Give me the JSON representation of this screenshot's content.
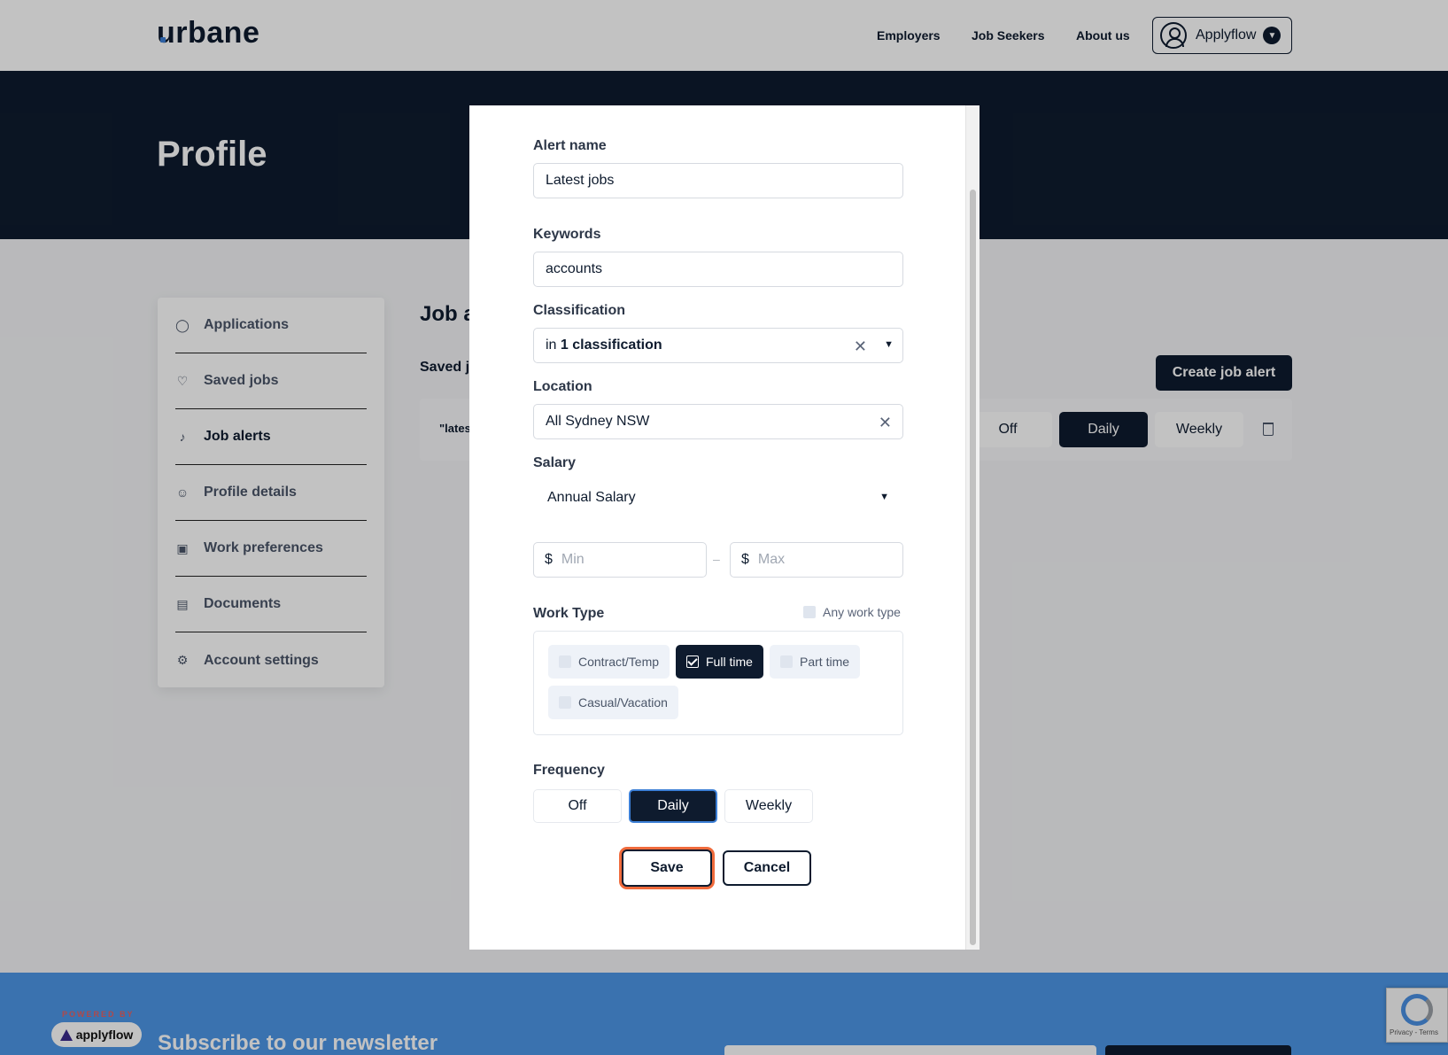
{
  "header": {
    "logo": "urbane",
    "nav": [
      "Employers",
      "Job Seekers",
      "About us"
    ],
    "account_label": "Applyflow"
  },
  "hero": {
    "title": "Profile"
  },
  "sidebar": {
    "items": [
      {
        "label": "Applications",
        "icon": "check-circle-icon"
      },
      {
        "label": "Saved jobs",
        "icon": "heart-icon"
      },
      {
        "label": "Job alerts",
        "icon": "bell-icon",
        "active": true
      },
      {
        "label": "Profile details",
        "icon": "user-circle-icon"
      },
      {
        "label": "Work preferences",
        "icon": "briefcase-icon"
      },
      {
        "label": "Documents",
        "icon": "document-icon"
      },
      {
        "label": "Account settings",
        "icon": "gear-icon"
      }
    ]
  },
  "main": {
    "heading": "Job a",
    "saved_heading": "Saved jo",
    "create_alert_label": "Create job alert",
    "alert_row": {
      "name": "\"lates",
      "freq_options": [
        "Off",
        "Daily",
        "Weekly"
      ],
      "selected": "Daily"
    }
  },
  "modal": {
    "alert_name": {
      "label": "Alert name",
      "value": "Latest jobs"
    },
    "keywords": {
      "label": "Keywords",
      "value": "accounts"
    },
    "classification": {
      "label": "Classification",
      "prefix": "in",
      "count": "1",
      "suffix": "classification"
    },
    "location": {
      "label": "Location",
      "value": "All Sydney NSW"
    },
    "salary": {
      "label": "Salary",
      "type": "Annual Salary",
      "currency": "$",
      "min_placeholder": "Min",
      "max_placeholder": "Max",
      "separator": "–"
    },
    "work_type": {
      "label": "Work Type",
      "any_label": "Any work type",
      "options": [
        {
          "label": "Contract/Temp",
          "checked": false
        },
        {
          "label": "Full time",
          "checked": true
        },
        {
          "label": "Part time",
          "checked": false
        },
        {
          "label": "Casual/Vacation",
          "checked": false
        }
      ]
    },
    "frequency": {
      "label": "Frequency",
      "options": [
        "Off",
        "Daily",
        "Weekly"
      ],
      "selected": "Daily"
    },
    "save_label": "Save",
    "cancel_label": "Cancel"
  },
  "footer": {
    "powered_by": "POWERED BY",
    "brand": "applyflow",
    "newsletter": "Subscribe to our newsletter",
    "recaptcha_text": "Privacy - Terms"
  },
  "colors": {
    "navy": "#0e1b2e",
    "footer_blue": "#4d96e6",
    "focus_orange": "#f06b3c",
    "accent_blue": "#3c7fd6"
  }
}
